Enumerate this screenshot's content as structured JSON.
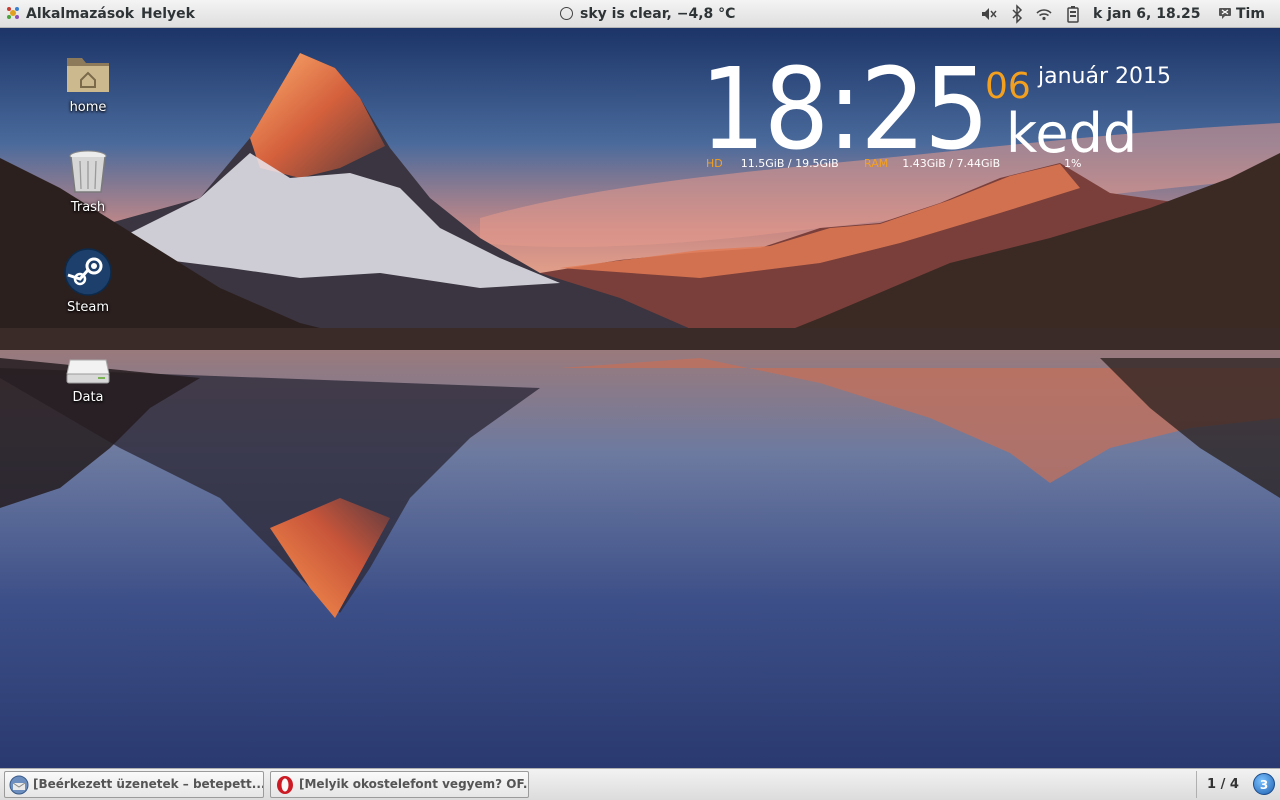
{
  "topbar": {
    "applications_label": "Alkalmazások",
    "places_label": "Helyek",
    "weather_text": "sky is clear, −4,8 °C",
    "clock_text": "k jan  6, 18.25",
    "user_name": "Tim",
    "icons": [
      "applications-icon",
      "weather-icon",
      "volume-muted-icon",
      "bluetooth-icon",
      "wifi-icon",
      "battery-icon",
      "user-status-icon"
    ]
  },
  "desktop": {
    "icons": [
      {
        "label": "home",
        "icon": "home-folder-icon"
      },
      {
        "label": "Trash",
        "icon": "trash-icon"
      },
      {
        "label": "Steam",
        "icon": "steam-icon"
      },
      {
        "label": "Data",
        "icon": "drive-icon"
      }
    ]
  },
  "conky": {
    "time": "18:25",
    "day": "06",
    "month_year": "január 2015",
    "weekday": "kedd",
    "hd_key": "HD",
    "hd_value": "11.5GiB / 19.5GiB",
    "ram_key": "RAM",
    "ram_value": "1.43GiB / 7.44GiB",
    "cpu_value": "1%",
    "accent_color": "#f4a01f"
  },
  "taskbar": {
    "tasks": [
      {
        "label": "[Beérkezett üzenetek – betepett....",
        "icon": "thunderbird-icon"
      },
      {
        "label": "[Melyik okostelefont vegyem? OF...",
        "icon": "opera-icon"
      }
    ],
    "workspace": "1 / 4",
    "notification_count": "3"
  }
}
